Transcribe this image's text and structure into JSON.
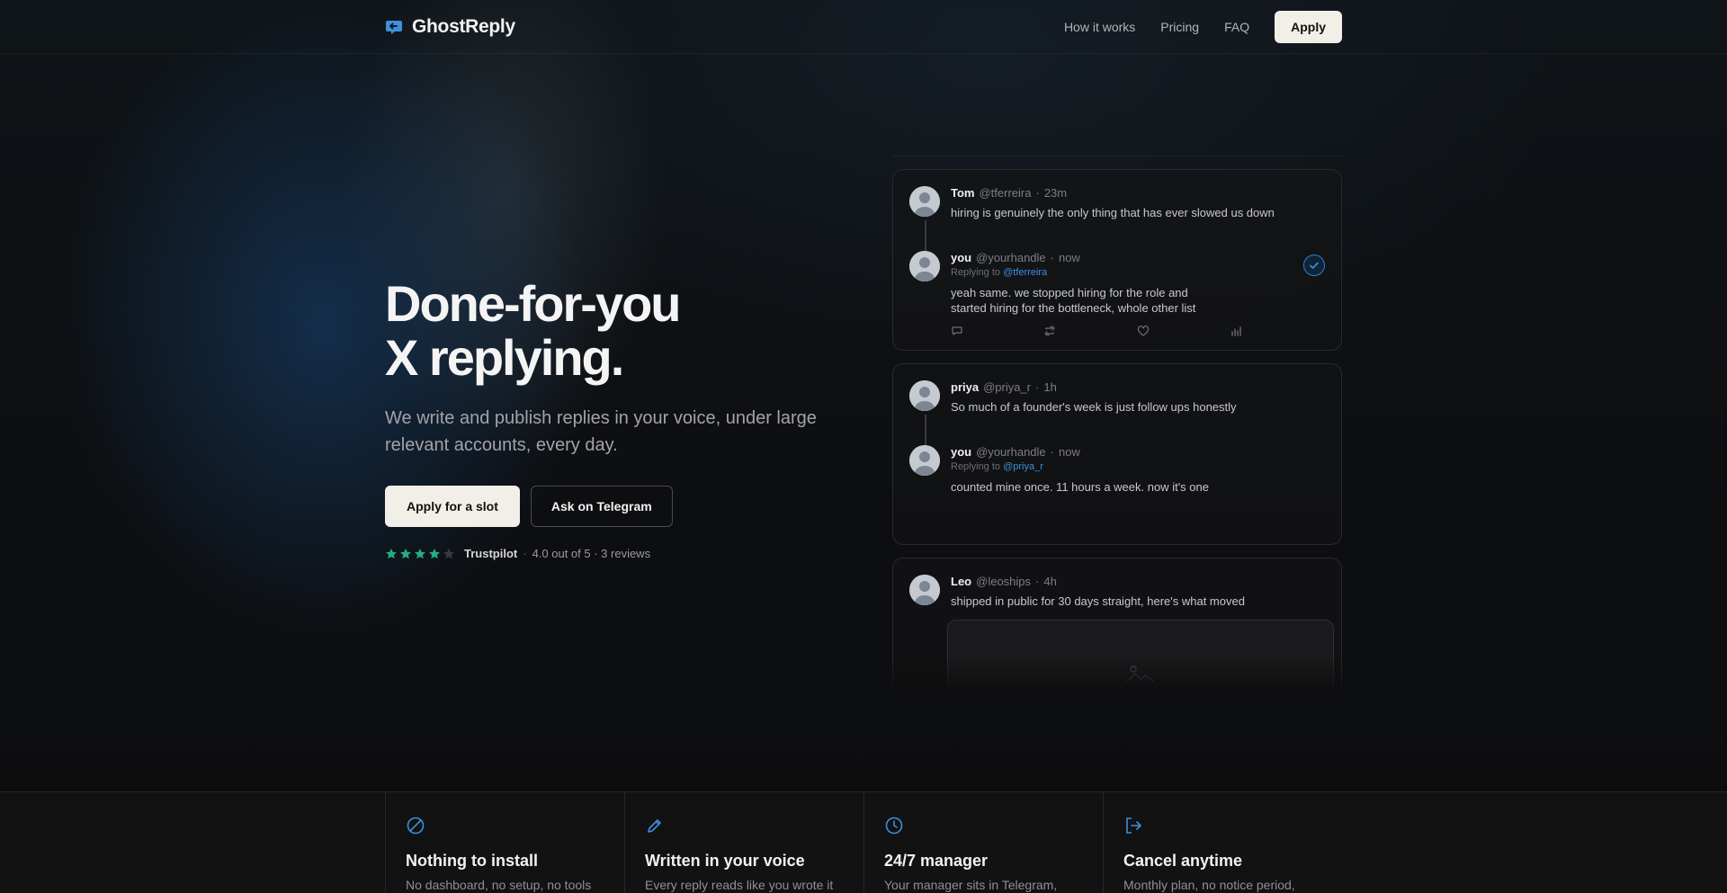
{
  "brand": {
    "name": "GhostReply",
    "accent": "#3d8fdc"
  },
  "nav": {
    "links": [
      "How it works",
      "Pricing",
      "FAQ"
    ],
    "apply_label": "Apply"
  },
  "hero": {
    "title_line1": "Done-for-you",
    "title_line2": "X replying.",
    "subtitle": "We write and publish replies in your voice, under large relevant accounts, every day.",
    "primary_cta": "Apply for a slot",
    "secondary_cta": "Ask on Telegram",
    "rating": {
      "stars_filled": 4,
      "stars_total": 5,
      "star_color": "#22b07d",
      "source": "Trustpilot",
      "separator": "·",
      "summary": "4.0 out of 5 · 3 reviews"
    }
  },
  "feed": [
    {
      "original": {
        "name": "Tom",
        "handle": "@tferreira",
        "dot": "·",
        "time": "23m",
        "text": "hiring is genuinely the only thing that has ever slowed us down"
      },
      "reply": {
        "name": "you",
        "handle": "@yourhandle",
        "dot": "·",
        "time": "now",
        "replying_prefix": "Replying to",
        "replying_to": "@tferreira",
        "text_line1": "yeah same. we stopped hiring for the role and",
        "text_line2": "started hiring for the bottleneck, whole other list"
      }
    },
    {
      "original": {
        "name": "priya",
        "handle": "@priya_r",
        "dot": "·",
        "time": "1h",
        "text": "So much of a founder's week is just follow ups honestly"
      },
      "reply": {
        "name": "you",
        "handle": "@yourhandle",
        "dot": "·",
        "time": "now",
        "replying_prefix": "Replying to",
        "replying_to": "@priya_r",
        "text_line1": "counted mine once. 11 hours a week. now it's one"
      }
    },
    {
      "original": {
        "name": "Leo",
        "handle": "@leoships",
        "dot": "·",
        "time": "4h",
        "text": "shipped in public for 30 days straight, here's what moved"
      }
    }
  ],
  "features": [
    {
      "icon": "slash-circle-icon",
      "title": "Nothing to install",
      "desc": "No dashboard, no setup, no tools"
    },
    {
      "icon": "pencil-icon",
      "title": "Written in your voice",
      "desc": "Every reply reads like you wrote it"
    },
    {
      "icon": "clock-icon",
      "title": "24/7 manager",
      "desc": "Your manager sits in Telegram,"
    },
    {
      "icon": "exit-icon",
      "title": "Cancel anytime",
      "desc": "Monthly plan, no notice period,"
    }
  ]
}
